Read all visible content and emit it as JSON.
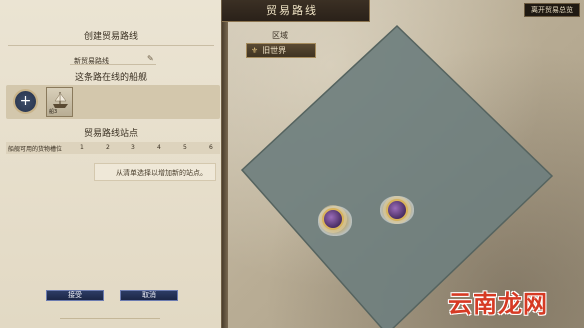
{
  "header": {
    "title": "贸易路线",
    "leave_button": "离开贸易总览"
  },
  "panel": {
    "title": "创建贸易路线",
    "route_name": "新贸易路线",
    "ships_section_title": "这条路在线的船舰",
    "ship_card_label": "船3",
    "stops_section_title": "贸易路线站点",
    "cargo_slots_label": "船舰可用的货物槽位",
    "cargo_slots": [
      "1",
      "2",
      "3",
      "4",
      "5",
      "6"
    ],
    "hint": "从清单选择以增加新的站点。",
    "accept_button": "接受",
    "cancel_button": "取消"
  },
  "map": {
    "region_label": "区域",
    "region_tag": "旧世界",
    "watermark": "云南龙网"
  },
  "colors": {
    "accent": "#2c3b64",
    "sea": "#6f7f7e",
    "banner": "#2a2119"
  }
}
